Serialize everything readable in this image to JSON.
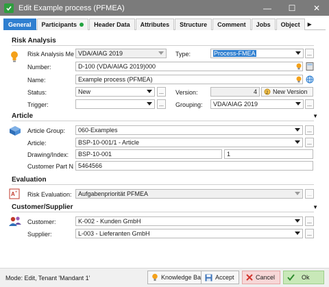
{
  "window": {
    "title": "Edit Example process (PFMEA)",
    "minimize": "—",
    "maximize": "☐",
    "close": "✕"
  },
  "tabs": [
    {
      "label": "General",
      "active": true
    },
    {
      "label": "Participants"
    },
    {
      "label": "Header Data"
    },
    {
      "label": "Attributes"
    },
    {
      "label": "Structure"
    },
    {
      "label": "Comment"
    },
    {
      "label": "Jobs"
    },
    {
      "label": "Object"
    }
  ],
  "risk_analysis": {
    "title": "Risk Analysis",
    "risk_method_label": "Risk Analysis Me...",
    "risk_method_value": "VDA/AIAG 2019",
    "type_label": "Type:",
    "type_value": "Process-FMEA",
    "number_label": "Number:",
    "number_value": "D-100 (VDA/AIAG 2019)000",
    "name_label": "Name:",
    "name_value": "Example process (PFMEA)",
    "status_label": "Status:",
    "status_value": "New",
    "version_label": "Version:",
    "version_value": "4",
    "new_version_label": "New Version",
    "trigger_label": "Trigger:",
    "trigger_value": "",
    "grouping_label": "Grouping:",
    "grouping_value": "VDA/AIAG 2019"
  },
  "article": {
    "title": "Article",
    "group_label": "Article Group:",
    "group_value": "060-Examples",
    "article_label": "Article:",
    "article_value": "BSP-10-001/1 - Article",
    "drawing_label": "Drawing/Index:",
    "drawing_value": "BSP-10-001",
    "index_value": "1",
    "customer_part_label": "Customer Part N...",
    "customer_part_value": "5464566"
  },
  "evaluation": {
    "title": "Evaluation",
    "risk_eval_label": "Risk Evaluation:",
    "risk_eval_value": "Aufgabenpriorität PFMEA"
  },
  "customer_supplier": {
    "title": "Customer/Supplier",
    "customer_label": "Customer:",
    "customer_value": "K-002 - Kunden GmbH",
    "supplier_label": "Supplier:",
    "supplier_value": "L-003 - Lieferanten GmbH"
  },
  "dots_label": "...",
  "status": {
    "mode": "Mode: Edit, Tenant 'Mandant 1'",
    "knowledge_base": "Knowledge Base",
    "accept": "Accept",
    "cancel": "Cancel",
    "ok": "Ok"
  }
}
